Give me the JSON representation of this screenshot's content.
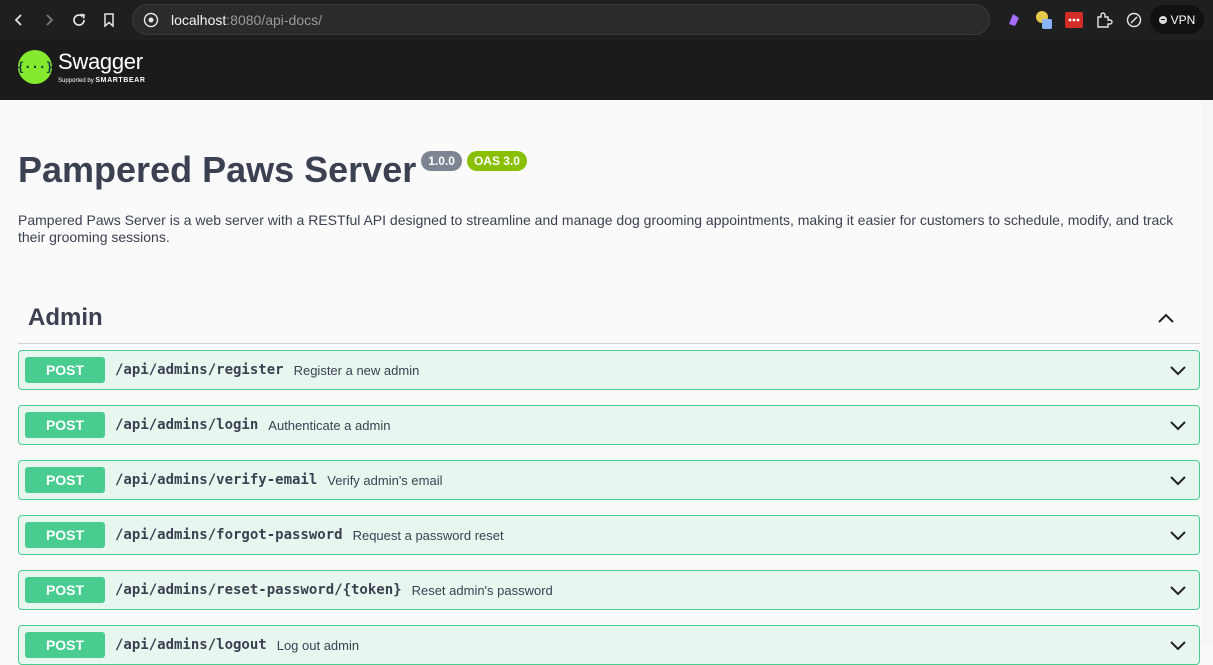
{
  "browser": {
    "url_host": "localhost",
    "url_rest": ":8080/api-docs/",
    "vpn_label": "VPN"
  },
  "swagger": {
    "logo_word": "Swagger",
    "logo_supported": "Supported by",
    "logo_brand": "SMARTBEAR"
  },
  "info": {
    "title": "Pampered Paws Server",
    "version": "1.0.0",
    "oas": "OAS 3.0",
    "description": "Pampered Paws Server is a web server with a RESTful API designed to streamline and manage dog grooming appointments, making it easier for customers to schedule, modify, and track their grooming sessions."
  },
  "tag": {
    "name": "Admin"
  },
  "operations": [
    {
      "method": "POST",
      "path": "/api/admins/register",
      "summary": "Register a new admin"
    },
    {
      "method": "POST",
      "path": "/api/admins/login",
      "summary": "Authenticate a admin"
    },
    {
      "method": "POST",
      "path": "/api/admins/verify-email",
      "summary": "Verify admin's email"
    },
    {
      "method": "POST",
      "path": "/api/admins/forgot-password",
      "summary": "Request a password reset"
    },
    {
      "method": "POST",
      "path": "/api/admins/reset-password/{token}",
      "summary": "Reset admin's password"
    },
    {
      "method": "POST",
      "path": "/api/admins/logout",
      "summary": "Log out admin"
    }
  ],
  "colors": {
    "post": "#49cc90",
    "post_bg": "#e8f6f0",
    "header": "#1b1b1b",
    "accent": "#85ea2d"
  }
}
